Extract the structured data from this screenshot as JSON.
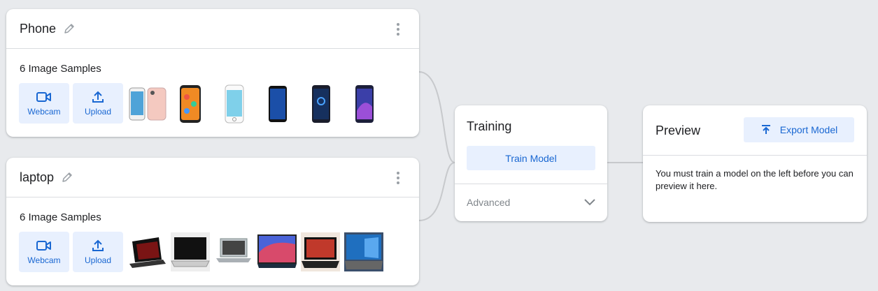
{
  "classes": [
    {
      "name": "Phone",
      "samples_label": "6 Image Samples",
      "webcam_label": "Webcam",
      "upload_label": "Upload"
    },
    {
      "name": "laptop",
      "samples_label": "6 Image Samples",
      "webcam_label": "Webcam",
      "upload_label": "Upload"
    }
  ],
  "training": {
    "title": "Training",
    "train_button": "Train Model",
    "advanced_label": "Advanced"
  },
  "preview": {
    "title": "Preview",
    "export_button": "Export Model",
    "message": "You must train a model on the left before you can preview it here."
  },
  "colors": {
    "accent": "#1967d2",
    "button_bg": "#e8f0fe",
    "background": "#e8eaed"
  }
}
